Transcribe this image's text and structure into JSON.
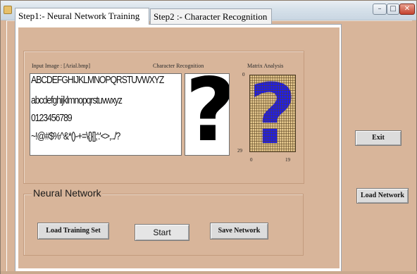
{
  "window": {
    "title": ""
  },
  "tabs": [
    {
      "label": "Step1:- Neural Network Training",
      "active": true
    },
    {
      "label": "Step2 :- Character Recognition",
      "active": false
    }
  ],
  "input_panel": {
    "label": "Input Image : [Arial.bmp]",
    "lines": [
      "ABCDEFGHIJKLMNOPQRSTUVWXYZ",
      "abcdefghijklmnopqrstuvwxyz",
      "0123456789",
      "~!@#$%^&*()-+=\\{}[];':'<>,../?"
    ]
  },
  "recognition_panel": {
    "label": "Character Recognition",
    "character": "?"
  },
  "matrix_panel": {
    "label": "Matrix Analysis",
    "y_min_label": "0",
    "y_max_label": "29",
    "x_min_label": "0",
    "x_max_label": "19",
    "cols": 20,
    "rows": 30,
    "grid_color": "#5a4322",
    "cell_color": "#e6c98f",
    "fill_color": "#1a1aff"
  },
  "neural_network_group": {
    "title": "Neural Network"
  },
  "buttons": {
    "load_training_set": "Load Training Set",
    "start": "Start",
    "save_network": "Save Network",
    "exit": "Exit",
    "load_network": "Load Network"
  },
  "colors": {
    "window_bg": "#d8b59a",
    "tab_active_bg": "#ffffff",
    "matrix_fill": "#1a1aff"
  }
}
